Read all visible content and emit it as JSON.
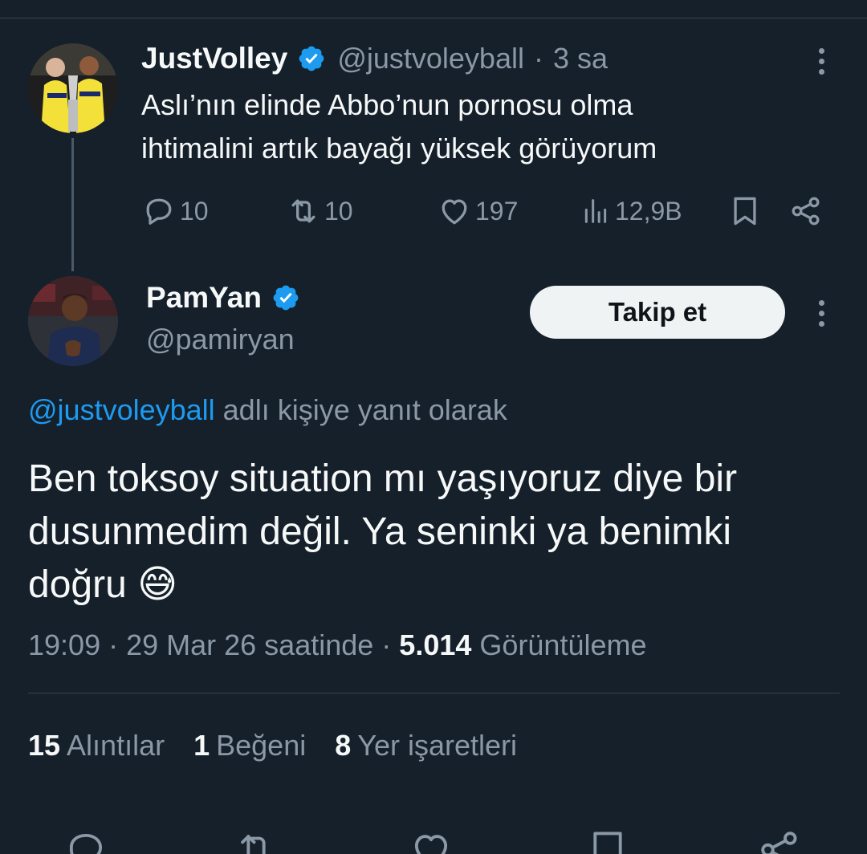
{
  "tweet_1": {
    "display_name": "JustVolley",
    "handle": "@justvoleyball",
    "time_sep": "·",
    "time": "3 sa",
    "text_lines": [
      "Aslı’nın elinde Abbo’nun pornosu olma",
      "ihtimalini artık bayağı yüksek görüyorum"
    ],
    "actions": {
      "replies": "10",
      "retweets": "10",
      "likes": "197",
      "views": "12,9B"
    }
  },
  "tweet_2": {
    "display_name": "PamYan",
    "handle": "@pamiryan",
    "follow_label": "Takip et",
    "reply_to_handle": "@justvoleyball",
    "reply_to_suffix": " adlı kişiye yanıt olarak",
    "text_lines": [
      "Ben toksoy situation mı yaşıyoruz diye bir",
      "dusunmedim değil. Ya seninki ya benimki",
      "doğru 😅"
    ],
    "meta": {
      "time": "19:09",
      "sep1": " · ",
      "date": "29 Mar 26 saatinde",
      "sep2": " · ",
      "views_count": "5.014",
      "views_label": " Görüntüleme"
    },
    "stats": {
      "quotes_count": "15",
      "quotes_label": "Alıntılar",
      "likes_count": "1",
      "likes_label": "Beğeni",
      "bookmarks_count": "8",
      "bookmarks_label": "Yer işaretleri"
    }
  },
  "colors": {
    "background": "#15202b",
    "accent": "#1d9bf0",
    "secondary_text": "#8b98a5",
    "primary_text": "#f7f9f9"
  },
  "icons": [
    "verified-badge-icon",
    "more-icon",
    "reply-icon",
    "retweet-icon",
    "like-icon",
    "views-icon",
    "bookmark-icon",
    "share-icon"
  ]
}
